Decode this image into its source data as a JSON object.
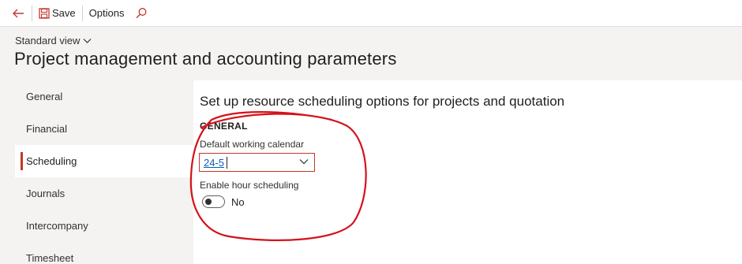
{
  "toolbar": {
    "back_icon": "back-arrow-icon",
    "save_icon": "save-icon",
    "save_label": "Save",
    "options_label": "Options",
    "search_icon": "search-icon"
  },
  "header": {
    "view_label": "Standard view",
    "page_title": "Project management and accounting parameters"
  },
  "nav": {
    "items": [
      {
        "label": "General"
      },
      {
        "label": "Financial"
      },
      {
        "label": "Scheduling"
      },
      {
        "label": "Journals"
      },
      {
        "label": "Intercompany"
      },
      {
        "label": "Timesheet"
      }
    ],
    "active": "Scheduling"
  },
  "content": {
    "section_title": "Set up resource scheduling options for projects and quotation",
    "group_heading": "GENERAL",
    "calendar_label": "Default working calendar",
    "calendar_value": "24-5",
    "hour_label": "Enable hour scheduling",
    "hour_value": "No"
  },
  "colors": {
    "accent_red": "#c0392b",
    "annotation_red": "#d4111a",
    "link_blue": "#0f5bb5"
  }
}
